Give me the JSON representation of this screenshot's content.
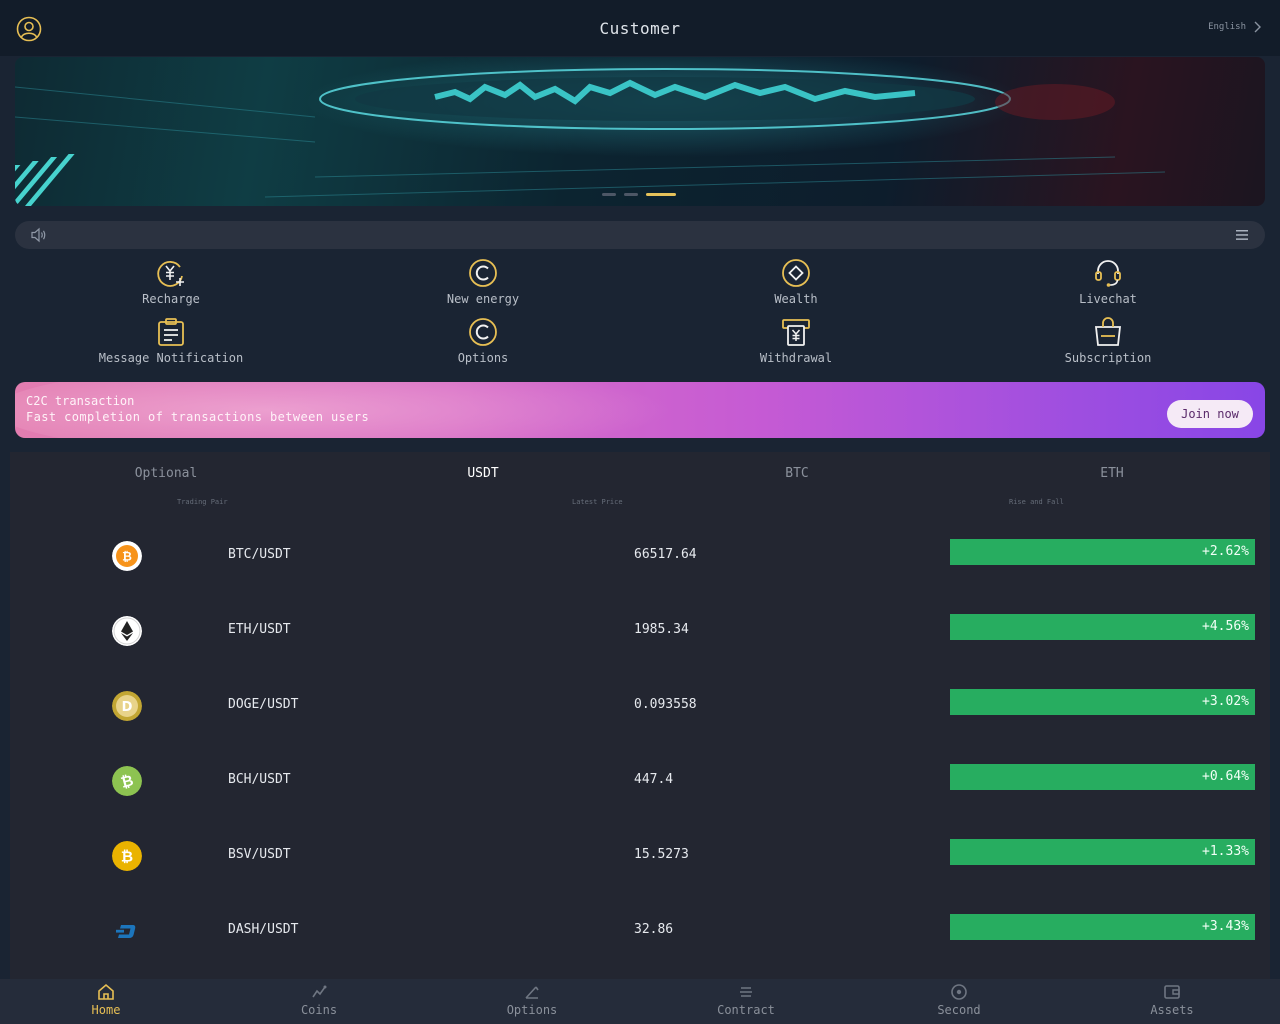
{
  "header": {
    "title": "Customer",
    "language": "English"
  },
  "banner": {
    "slides": 3,
    "active_slide": 3
  },
  "quick_menu": [
    {
      "label": "Recharge",
      "icon": "recharge-yen-icon"
    },
    {
      "label": "New energy",
      "icon": "copyright-c-icon"
    },
    {
      "label": "Wealth",
      "icon": "diamond-circle-icon"
    },
    {
      "label": "Livechat",
      "icon": "headset-icon"
    },
    {
      "label": "Message Notification",
      "icon": "clipboard-icon"
    },
    {
      "label": "Options",
      "icon": "copyright-c-icon"
    },
    {
      "label": "Withdrawal",
      "icon": "atm-yen-icon"
    },
    {
      "label": "Subscription",
      "icon": "shopping-bag-icon"
    }
  ],
  "promo": {
    "title": "C2C transaction",
    "subtitle": "Fast completion of transactions between users",
    "button": "Join now"
  },
  "market": {
    "tabs": [
      "Optional",
      "USDT",
      "BTC",
      "ETH"
    ],
    "active_tab": "USDT",
    "columns": [
      "Trading Pair",
      "Latest Price",
      "Rise and Fall"
    ],
    "rows": [
      {
        "pair": "BTC/USDT",
        "price": "66517.64",
        "change": "+2.62%",
        "coin": "btc"
      },
      {
        "pair": "ETH/USDT",
        "price": "1985.34",
        "change": "+4.56%",
        "coin": "eth"
      },
      {
        "pair": "DOGE/USDT",
        "price": "0.093558",
        "change": "+3.02%",
        "coin": "doge"
      },
      {
        "pair": "BCH/USDT",
        "price": "447.4",
        "change": "+0.64%",
        "coin": "bch"
      },
      {
        "pair": "BSV/USDT",
        "price": "15.5273",
        "change": "+1.33%",
        "coin": "bsv"
      },
      {
        "pair": "DASH/USDT",
        "price": "32.86",
        "change": "+3.43%",
        "coin": "dash"
      }
    ]
  },
  "bottom_nav": [
    {
      "label": "Home",
      "icon": "home-icon",
      "active": true
    },
    {
      "label": "Coins",
      "icon": "coins-chart-icon",
      "active": false
    },
    {
      "label": "Options",
      "icon": "options-icon",
      "active": false
    },
    {
      "label": "Contract",
      "icon": "contract-icon",
      "active": false
    },
    {
      "label": "Second",
      "icon": "second-target-icon",
      "active": false
    },
    {
      "label": "Assets",
      "icon": "wallet-icon",
      "active": false
    }
  ],
  "colors": {
    "accent": "#e7bf54",
    "up": "#27ad60",
    "background": "#1a2433",
    "panel": "#232631"
  }
}
